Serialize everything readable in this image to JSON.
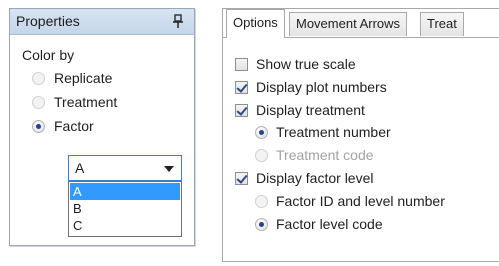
{
  "properties": {
    "title": "Properties",
    "pin_icon": "pin-icon",
    "color_by_label": "Color by",
    "options": [
      {
        "label": "Replicate",
        "selected": false
      },
      {
        "label": "Treatment",
        "selected": false
      },
      {
        "label": "Factor",
        "selected": true
      }
    ],
    "combo_value": "A",
    "dropdown_items": [
      "A",
      "B",
      "C"
    ],
    "dropdown_selected": "A"
  },
  "options_panel": {
    "tabs": [
      "Options",
      "Movement Arrows",
      "Treat"
    ],
    "active_tab": "Options",
    "show_true_scale": "Show true scale",
    "display_plot_numbers": "Display plot numbers",
    "display_treatment": "Display treatment",
    "treatment_number": "Treatment number",
    "treatment_code": "Treatment code",
    "display_factor_level": "Display factor level",
    "factor_id_level": "Factor ID and level number",
    "factor_level_code": "Factor level code"
  },
  "colors": {
    "header_bg": "#c4d6ea",
    "selection_blue": "#3299ff",
    "radio_dot": "#24428d"
  }
}
